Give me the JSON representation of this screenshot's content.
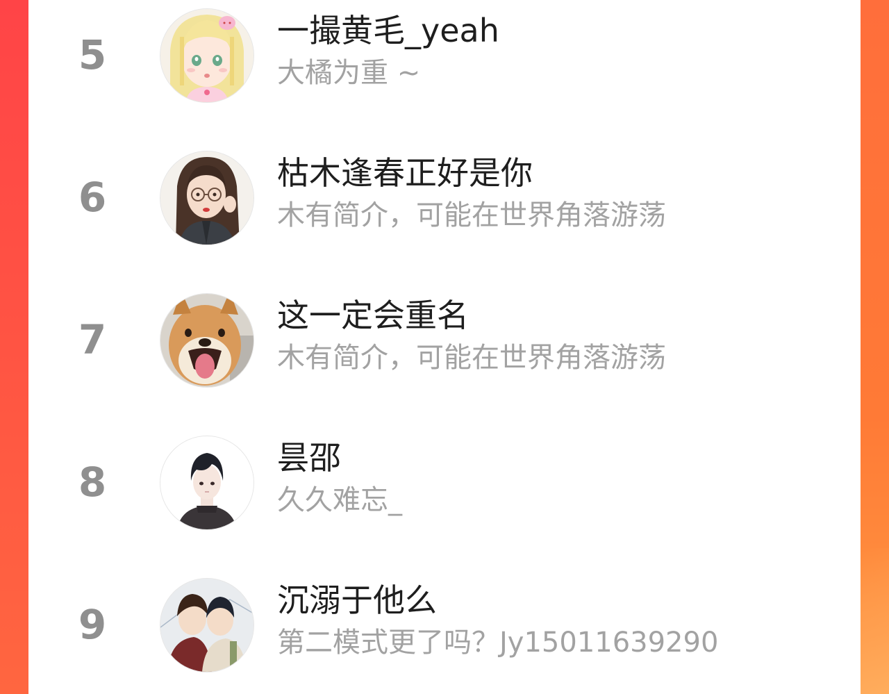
{
  "ranking": {
    "rows": [
      {
        "rank": "5",
        "name": "一撮黄毛_yeah",
        "bio": "大橘为重 ~",
        "avatar_icon": "anime-girl-blonde-avatar"
      },
      {
        "rank": "6",
        "name": "枯木逢春正好是你",
        "bio": "木有简介，可能在世界角落游荡",
        "avatar_icon": "girl-with-glasses-avatar"
      },
      {
        "rank": "7",
        "name": "这一定会重名",
        "bio": "木有简介，可能在世界角落游荡",
        "avatar_icon": "shiba-dog-avatar"
      },
      {
        "rank": "8",
        "name": "昙邵",
        "bio": "久久难忘_",
        "avatar_icon": "anime-boy-black-hair-avatar"
      },
      {
        "rank": "9",
        "name": "沉溺于他么",
        "bio": "第二模式更了吗？Jy15011639290",
        "avatar_icon": "anime-couple-avatar"
      }
    ]
  },
  "colors": {
    "background_left": "#ff4447",
    "background_right": "#ff7a36",
    "card": "#ffffff",
    "rank_number": "#8f8f8f",
    "name_text": "#1e1e1e",
    "bio_text": "#a2a2a2"
  }
}
